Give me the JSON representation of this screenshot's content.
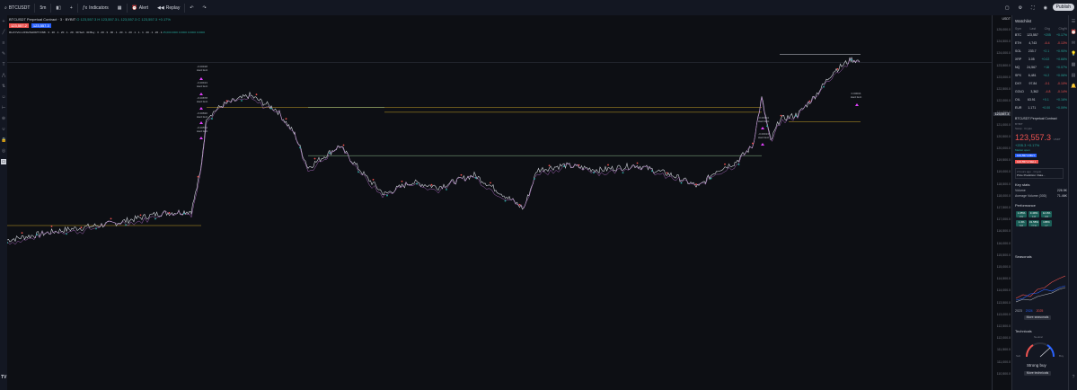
{
  "topbar": {
    "symbol": "BTCUSDT",
    "interval": "5m",
    "indicators": "Indicators",
    "alert": "Alert",
    "replay": "Replay",
    "publish": "Publish"
  },
  "legend": {
    "title": "BTCUSDT Perpetual Contract · 3 · BYBIT",
    "ohlc": "O 123,557.3 H 123,557.3 L 123,557.3 C 123,557.3 +0.17%",
    "sell_box": "123,557.2",
    "buy_box": "123,557.3",
    "indicator_line": "RLZ FVG LONG/SHORT FIN8 · 3 · 20 · 1 · 20 · 1 · 20 · 30 Sell · 30 Buy · 3 · 20 · 3 · 30 · 1 · 20 · 1 · 20 · 1 · 1 · 1 · 20 · 1 · 20 · 1",
    "indicator_vals": "25,000.0000  0.0000  0.0000  0.0000"
  },
  "annotations": [
    {
      "price": "-0.00918",
      "label": "Hard Exit"
    },
    {
      "price": "-0.00913",
      "label": "Hard Exit"
    },
    {
      "price": "-0.00878",
      "label": "Hard Exit"
    },
    {
      "price": "-0.00820",
      "label": "Hard Exit"
    },
    {
      "price": "-0.00554",
      "label": "Hard Exit"
    },
    {
      "price": "-0.00324",
      "label": "Hard Exit"
    },
    {
      "price": "-0.00013",
      "label": "Hard Exit"
    },
    {
      "price": "0.00004",
      "label": "Hard Exit"
    }
  ],
  "price_axis": {
    "labels": [
      "125,000.0",
      "124,500.0",
      "124,000.0",
      "123,500.0",
      "123,000.0",
      "122,500.0",
      "122,000.0",
      "121,500.0",
      "121,000.0",
      "120,500.0",
      "120,000.0",
      "119,500.0",
      "119,000.0",
      "118,500.0",
      "118,000.0",
      "117,500.0",
      "117,000.0",
      "116,500.0",
      "116,000.0",
      "115,500.0",
      "115,000.0",
      "114,500.0",
      "114,000.0",
      "113,500.0",
      "113,000.0",
      "112,500.0",
      "112,000.0",
      "111,500.0",
      "111,000.0",
      "110,500.0"
    ],
    "current": "123,557.3",
    "currency": "USDT"
  },
  "watchlist": {
    "header": "Watchlist",
    "columns": [
      "Sym",
      "Last",
      "Chg",
      "Chg%"
    ],
    "items": [
      {
        "sym": "BTC",
        "last": "123,557",
        "chg": "+205",
        "pct": "+0.17%",
        "color": "#26a69a"
      },
      {
        "sym": "ETH",
        "last": "4,743",
        "chg": "-6.4",
        "pct": "-0.13%",
        "color": "#ef5350"
      },
      {
        "sym": "SOL",
        "last": "233.7",
        "chg": "+2.1",
        "pct": "+0.90%",
        "color": "#26a69a"
      },
      {
        "sym": "XRP",
        "last": "3.05",
        "chg": "+0.02",
        "pct": "+0.66%",
        "color": "#26a69a"
      },
      {
        "sym": "NQ",
        "last": "24,567",
        "chg": "+18",
        "pct": "+0.07%",
        "color": "#26a69a"
      },
      {
        "sym": "SPX",
        "last": "6,481",
        "chg": "+4.2",
        "pct": "+0.06%",
        "color": "#26a69a"
      },
      {
        "sym": "DXY",
        "last": "97.84",
        "chg": "-0.1",
        "pct": "-0.10%",
        "color": "#ef5350"
      },
      {
        "sym": "GOLD",
        "last": "3,362",
        "chg": "-4.8",
        "pct": "-0.14%",
        "color": "#ef5350"
      },
      {
        "sym": "OIL",
        "last": "63.91",
        "chg": "+0.1",
        "pct": "+0.16%",
        "color": "#26a69a"
      },
      {
        "sym": "EUR",
        "last": "1.171",
        "chg": "+0.00",
        "pct": "+0.09%",
        "color": "#26a69a"
      }
    ]
  },
  "details": {
    "symbol": "BTCUSDT Perpetual Contract",
    "exchange": "BYBIT",
    "category": "Swap · Crypto",
    "price": "123,557.3",
    "currency": "USDT",
    "change": "+205.3 +0.17%",
    "status": "Market open",
    "sell": "123,557.2 SELL",
    "buy": "123,557.3 BUY",
    "news": "2 hours ago · Crypto",
    "news_title": "Price Prediction: Data...",
    "key_stats": "Key stats",
    "volume_label": "Volume",
    "volume": "226.9K",
    "avg_volume_label": "Average Volume (30D)",
    "avg_volume": "71.46K",
    "performance": "Performance",
    "perf": [
      {
        "v": "1.05%",
        "p": "1W"
      },
      {
        "v": "3.49%",
        "p": "1M"
      },
      {
        "v": "12.0%",
        "p": "3M"
      },
      {
        "v": "1.4%",
        "p": "6M"
      },
      {
        "v": "31.58%",
        "p": "YTD"
      },
      {
        "v": "105%",
        "p": "1Y"
      }
    ],
    "seasonals": "Seasonals",
    "seasonal_years": [
      "2023",
      "2024",
      "2025"
    ],
    "more_seasonals": "More seasonals",
    "technicals": "Technicals",
    "neutral": "Neutral",
    "sell_g": "Sell",
    "buy_g": "Buy",
    "rating": "Strong buy",
    "more_technicals": "More technicals"
  },
  "chart_data": {
    "type": "line",
    "series_main": {
      "color": "#d1d4dc"
    },
    "ylim": [
      110500,
      125000
    ]
  }
}
